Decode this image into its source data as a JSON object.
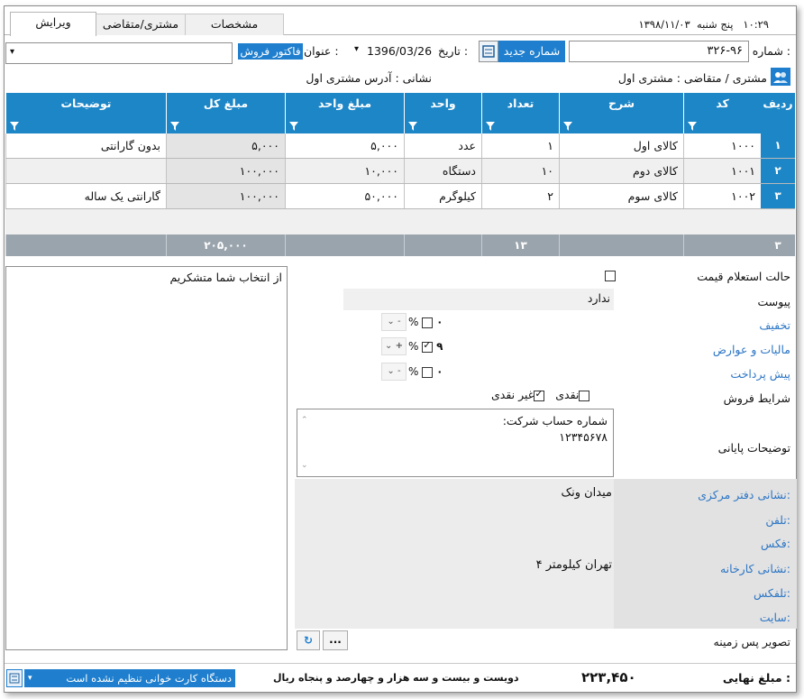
{
  "tabs": [
    {
      "label": "ویرایش",
      "active": true
    },
    {
      "label": "مشتری/متقاضی",
      "active": false
    },
    {
      "label": "مشخصات",
      "active": false
    }
  ],
  "top_info": {
    "day_label": "پنج شنبه",
    "date": "۱۳۹۸/۱۱/۰۳",
    "time": "۱۰:۲۹"
  },
  "header": {
    "number_label": "شماره :",
    "number_value": "۳۲۶-۹۶",
    "new_number_button": "شماره جدید",
    "date_label": "تاریخ :",
    "date_value": "1396/03/26",
    "title_label": "عنوان :",
    "title_value": "فاکتور فروش",
    "customer_label": "مشتری / متقاضی :",
    "customer_value": "مشتری اول",
    "address_label": "نشانی : آدرس مشتری اول"
  },
  "grid": {
    "columns": [
      "ردیف",
      "کد",
      "شرح",
      "تعداد",
      "واحد",
      "مبلغ واحد",
      "مبلغ کل",
      "توضیحات"
    ],
    "rows": [
      {
        "num": "۱",
        "code": "۱۰۰۰",
        "desc": "کالای اول",
        "qty": "۱",
        "unit": "عدد",
        "unit_price": "۵,۰۰۰",
        "total": "۵,۰۰۰",
        "notes": "بدون گارانتی"
      },
      {
        "num": "۲",
        "code": "۱۰۰۱",
        "desc": "کالای دوم",
        "qty": "۱۰",
        "unit": "دستگاه",
        "unit_price": "۱۰,۰۰۰",
        "total": "۱۰۰,۰۰۰",
        "notes": ""
      },
      {
        "num": "۳",
        "code": "۱۰۰۲",
        "desc": "کالای سوم",
        "qty": "۲",
        "unit": "کیلوگرم",
        "unit_price": "۵۰,۰۰۰",
        "total": "۱۰۰,۰۰۰",
        "notes": "گارانتی یک ساله"
      }
    ],
    "footer": {
      "row_count": "۳",
      "qty_sum": "۱۳",
      "total_sum": "۲۰۵,۰۰۰"
    }
  },
  "notes_panel": {
    "text": "از انتخاب شما متشکریم"
  },
  "form": {
    "price_inquiry_label": "حالت استعلام قیمت",
    "attachment_label": "پیوست",
    "attachment_value": "ندارد",
    "discount_label": "تخفیف",
    "taxes_label": "مالیات و عوارض",
    "prepayment_label": "پیش پرداخت",
    "sale_terms_label": "شرایط فروش",
    "footer_notes_label": "توضیحات پایانی",
    "footer_notes_line1": "شماره حساب شرکت:",
    "footer_notes_line2": "۱۲۳۴۵۶۷۸",
    "hq_address_label": "نشانی دفتر مرکزی:",
    "hq_address_value": "میدان ونک",
    "phone_label": "تلفن:",
    "fax_label": "فکس:",
    "factory_label": "نشانی کارخانه:",
    "factory_value": "تهران کیلومتر ۴",
    "telefax_label": "تلفکس:",
    "site_label": "سایت:",
    "background_label": "تصویر پس زمینه",
    "cash_label": "نقدی",
    "noncash_label": "غیر نقدی",
    "percent_symbol": "%",
    "discount_value": "۰",
    "discount_op": "-",
    "tax_value": "۹",
    "tax_op": "+",
    "prepay_value": "۰",
    "prepay_op": "-",
    "more_button": "...",
    "refresh_icon": "refresh-icon"
  },
  "bottom": {
    "final_label": "مبلغ نهایی :",
    "final_value": "۲۲۳,۴۵۰",
    "final_words": "دویست و بیست و سه هزار و چهارصد و پنجاه ریال",
    "cardreader_text": "دستگاه کارت خوانی تنظیم نشده است"
  },
  "colors": {
    "accent": "#1d86c6",
    "link": "#2c76c5",
    "footer_row": "#9aa4ad"
  }
}
